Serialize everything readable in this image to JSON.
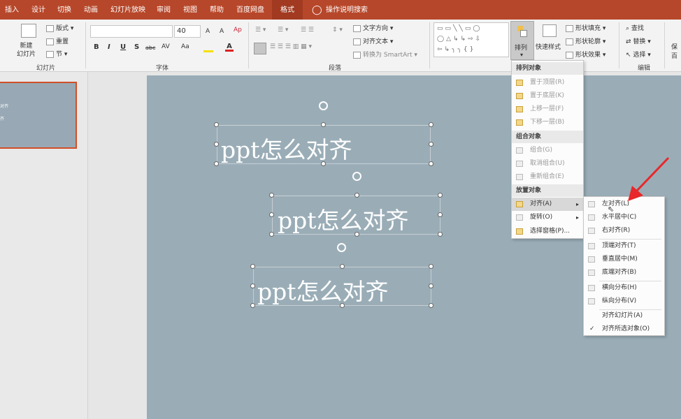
{
  "tabs": [
    "插入",
    "设计",
    "切换",
    "动画",
    "幻灯片放映",
    "审阅",
    "视图",
    "帮助",
    "百度网盘",
    "格式"
  ],
  "tell_me": "操作说明搜索",
  "ribbon": {
    "slides_group": {
      "new_slide": "新建\n幻灯片",
      "layout": "版式",
      "reset": "重置",
      "section": "节",
      "label": "幻灯片"
    },
    "font_group": {
      "font_name": "",
      "font_size": "40",
      "bold": "B",
      "italic": "I",
      "underline": "U",
      "shadow": "S",
      "strike": "abc",
      "spacing": "AV",
      "case": "Aa",
      "label": "字体"
    },
    "paragraph_group": {
      "text_direction": "文字方向",
      "align_text": "对齐文本",
      "smartart": "转换为 SmartArt",
      "label": "段落"
    },
    "drawing_group": {
      "arrange": "排列",
      "quick_styles": "快速样式",
      "shape_fill": "形状填充",
      "shape_outline": "形状轮廓",
      "shape_effects": "形状效果"
    },
    "editing_group": {
      "find": "查找",
      "replace": "替换",
      "select": "选择",
      "label": "编辑"
    },
    "truncated": {
      "a": "保",
      "b": "百"
    }
  },
  "thumbnail": {
    "line1": "对齐",
    "line2": "齐"
  },
  "slide": {
    "text_boxes": [
      "ppt怎么对齐",
      "ppt怎么对齐",
      "ppt怎么对齐"
    ]
  },
  "arrange_menu": {
    "sections": [
      {
        "header": "排列对象",
        "items": [
          "置于顶层(R)",
          "置于底层(K)",
          "上移一层(F)",
          "下移一层(B)"
        ]
      },
      {
        "header": "组合对象",
        "items": [
          "组合(G)",
          "取消组合(U)",
          "重新组合(E)"
        ]
      },
      {
        "header": "放置对象",
        "items": [
          "对齐(A)",
          "旋转(O)",
          "选择窗格(P)..."
        ]
      }
    ]
  },
  "align_submenu": {
    "items": [
      "左对齐(L)",
      "水平居中(C)",
      "右对齐(R)",
      "顶端对齐(T)",
      "垂直居中(M)",
      "底端对齐(B)",
      "横向分布(H)",
      "纵向分布(V)",
      "对齐幻灯片(A)",
      "对齐所选对象(O)"
    ],
    "check": "✓"
  },
  "colors": {
    "accent": "#b7472a",
    "slide_bg": "#9aadb7",
    "arrow": "#e8282b"
  }
}
